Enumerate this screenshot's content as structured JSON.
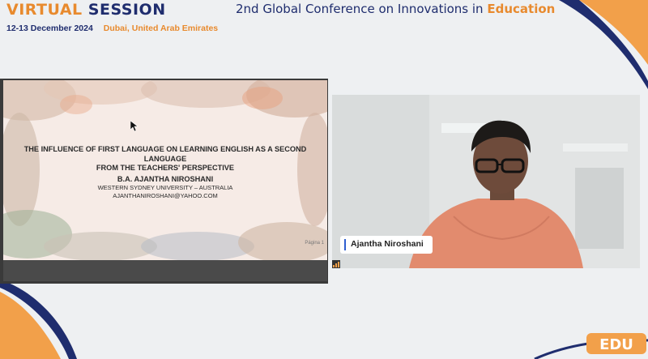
{
  "header": {
    "brand_word1": "VIRTUAL",
    "brand_word2": "SESSION",
    "date": "12-13 December 2024",
    "location": "Dubai, United Arab Emirates",
    "conference_prefix": "2nd Global Conference on Innovations in",
    "conference_highlight": "Education"
  },
  "slide": {
    "title_line1": "THE INFLUENCE OF FIRST LANGUAGE ON LEARNING ENGLISH AS A SECOND LANGUAGE",
    "title_line2": "FROM THE TEACHERS' PERSPECTIVE",
    "author": "B.A. AJANTHA NIROSHANI",
    "affiliation": "WESTERN SYDNEY UNIVERSITY – AUSTRALIA",
    "email": "AJANTHANIROSHANI@YAHOO.COM",
    "page_label": "Página 1"
  },
  "participant": {
    "name": "Ajantha Niroshani"
  },
  "footer": {
    "logo_text": "EDU"
  },
  "colors": {
    "orange": "#e88a2e",
    "navy": "#1f2d6e",
    "name_accent": "#2f5fd0"
  }
}
